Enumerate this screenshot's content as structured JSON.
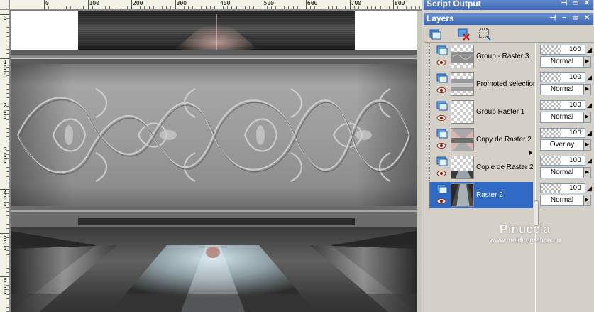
{
  "ruler": {
    "top_labels": [
      "0",
      "100",
      "200",
      "300",
      "400",
      "500",
      "600",
      "700",
      "800",
      "900"
    ],
    "left_labels": [
      "0",
      "1 0 0",
      "2 0 0",
      "3 0 0",
      "4 0 0",
      "5 0 0",
      "6 0 0"
    ]
  },
  "panels": {
    "script_output": {
      "title": "Script Output"
    },
    "layers": {
      "title": "Layers"
    }
  },
  "titlebar_buttons": {
    "pin": "⊣",
    "minimize": "−",
    "restore": "▭",
    "close": "✕"
  },
  "layers": [
    {
      "name": "Group - Raster 3",
      "opacity": "100",
      "blend": "Normal",
      "selected": false,
      "thumb": "group-raster3"
    },
    {
      "name": "Promoted selection",
      "opacity": "100",
      "blend": "Normal",
      "selected": false,
      "thumb": "promoted"
    },
    {
      "name": "Group Raster 1",
      "opacity": "100",
      "blend": "Normal",
      "selected": false,
      "thumb": "empty"
    },
    {
      "name": "Copy de Raster 2",
      "opacity": "100",
      "blend": "Overlay",
      "selected": false,
      "thumb": "copy2"
    },
    {
      "name": "Copie de Raster 2",
      "opacity": "100",
      "blend": "Normal",
      "selected": false,
      "thumb": "copie2"
    },
    {
      "name": "Raster 2",
      "opacity": "100",
      "blend": "Normal",
      "selected": true,
      "thumb": "raster2"
    }
  ],
  "watermark": {
    "name": "Pinuccia",
    "url": "www.maidiregrafica.eu"
  },
  "colors": {
    "selection": "#316ac5",
    "titlebar": "#3d68b8"
  }
}
